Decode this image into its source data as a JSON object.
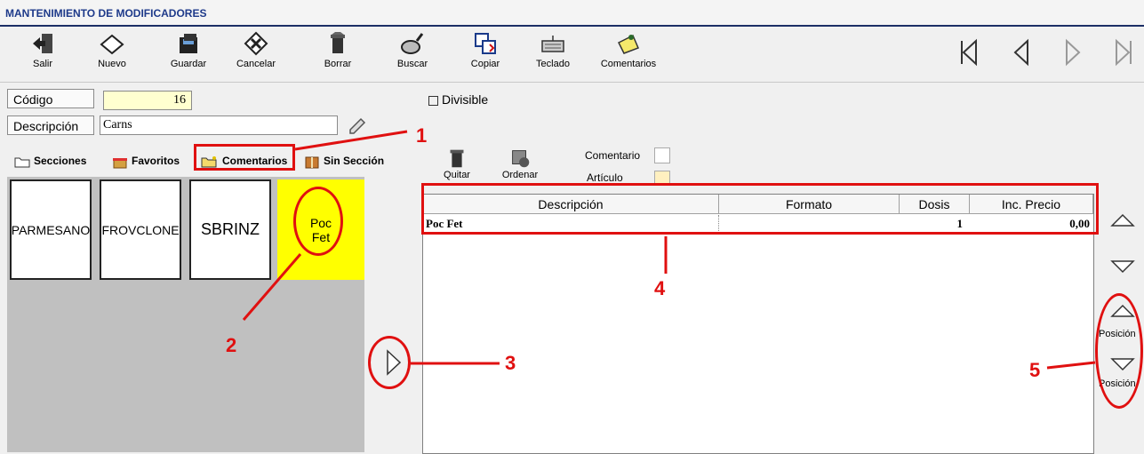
{
  "window": {
    "title": "MANTENIMIENTO DE MODIFICADORES"
  },
  "toolbar": {
    "buttons": [
      {
        "label": "Salir"
      },
      {
        "label": "Nuevo"
      },
      {
        "label": "Guardar"
      },
      {
        "label": "Cancelar"
      },
      {
        "label": "Borrar"
      },
      {
        "label": "Buscar"
      },
      {
        "label": "Copiar"
      },
      {
        "label": "Teclado"
      },
      {
        "label": "Comentarios"
      }
    ]
  },
  "form": {
    "codigo_label": "Código",
    "codigo_value": "16",
    "descripcion_label": "Descripción",
    "descripcion_value": "Carns",
    "divisible_label": "Divisible"
  },
  "tabs": [
    {
      "label": "Secciones"
    },
    {
      "label": "Favoritos"
    },
    {
      "label": "Comentarios"
    },
    {
      "label": "Sin Sección"
    }
  ],
  "cards": [
    {
      "label": "PARMESANO"
    },
    {
      "label": "FROVCLONE"
    },
    {
      "label": "SBRINZ"
    },
    {
      "line1": "Poc",
      "line2": "Fet"
    }
  ],
  "actions": {
    "quitar_label": "Quitar",
    "ordenar_label": "Ordenar",
    "comentario_label": "Comentario",
    "articulo_label": "Artículo"
  },
  "table": {
    "headers": [
      "Descripción",
      "Formato",
      "Dosis",
      "Inc. Precio"
    ],
    "rows": [
      {
        "descripcion": "Poc Fet",
        "formato": "",
        "dosis": "1",
        "inc_precio": "0,00"
      }
    ]
  },
  "side": {
    "posicion_up": "Posición",
    "posicion_down": "Posición"
  },
  "annotations": [
    "1",
    "2",
    "3",
    "4",
    "5"
  ],
  "colors": {
    "accent": "#1c2f66",
    "highlight": "#ffff00",
    "annotation": "#e01010",
    "code_field": "#ffffd0"
  }
}
